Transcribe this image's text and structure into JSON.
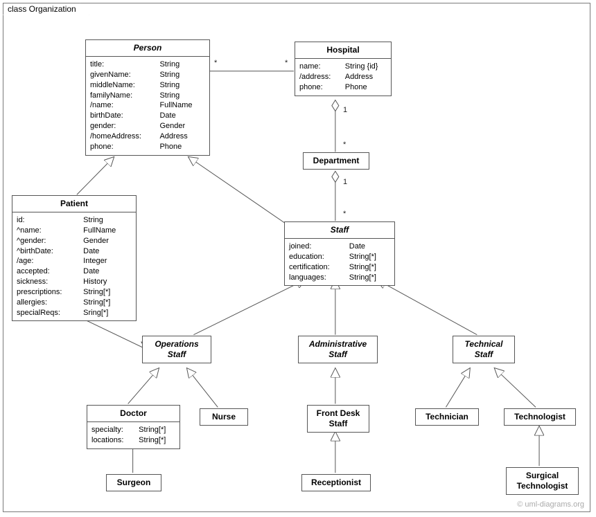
{
  "frame_label": "class Organization",
  "watermark": "© uml-diagrams.org",
  "classes": {
    "person": {
      "name": "Person",
      "attrs": [
        [
          "title:",
          "String"
        ],
        [
          "givenName:",
          "String"
        ],
        [
          "middleName:",
          "String"
        ],
        [
          "familyName:",
          "String"
        ],
        [
          "/name:",
          "FullName"
        ],
        [
          "birthDate:",
          "Date"
        ],
        [
          "gender:",
          "Gender"
        ],
        [
          "/homeAddress:",
          "Address"
        ],
        [
          "phone:",
          "Phone"
        ]
      ]
    },
    "hospital": {
      "name": "Hospital",
      "attrs": [
        [
          "name:",
          "String {id}"
        ],
        [
          "/address:",
          "Address"
        ],
        [
          "phone:",
          "Phone"
        ]
      ]
    },
    "department": {
      "name": "Department"
    },
    "patient": {
      "name": "Patient",
      "attrs": [
        [
          "id:",
          "String"
        ],
        [
          "^name:",
          "FullName"
        ],
        [
          "^gender:",
          "Gender"
        ],
        [
          "^birthDate:",
          "Date"
        ],
        [
          "/age:",
          "Integer"
        ],
        [
          "accepted:",
          "Date"
        ],
        [
          "sickness:",
          "History"
        ],
        [
          "prescriptions:",
          "String[*]"
        ],
        [
          "allergies:",
          "String[*]"
        ],
        [
          "specialReqs:",
          "Sring[*]"
        ]
      ]
    },
    "staff": {
      "name": "Staff",
      "attrs": [
        [
          "joined:",
          "Date"
        ],
        [
          "education:",
          "String[*]"
        ],
        [
          "certification:",
          "String[*]"
        ],
        [
          "languages:",
          "String[*]"
        ]
      ]
    },
    "opsstaff": {
      "name": "Operations\nStaff"
    },
    "adminstaff": {
      "name": "Administrative\nStaff"
    },
    "techstaff": {
      "name": "Technical\nStaff"
    },
    "doctor": {
      "name": "Doctor",
      "attrs": [
        [
          "specialty:",
          "String[*]"
        ],
        [
          "locations:",
          "String[*]"
        ]
      ]
    },
    "nurse": {
      "name": "Nurse"
    },
    "frontdesk": {
      "name": "Front Desk\nStaff"
    },
    "technician": {
      "name": "Technician"
    },
    "technologist": {
      "name": "Technologist"
    },
    "surgeon": {
      "name": "Surgeon"
    },
    "receptionist": {
      "name": "Receptionist"
    },
    "surgtech": {
      "name": "Surgical\nTechnologist"
    }
  },
  "mult": {
    "ph_star": "*",
    "hp_star": "*",
    "h_d_1": "1",
    "d_h_star": "*",
    "d_s_1": "1",
    "s_d_star": "*",
    "pat_ops_star_a": "*",
    "pat_ops_star_b": "*"
  }
}
